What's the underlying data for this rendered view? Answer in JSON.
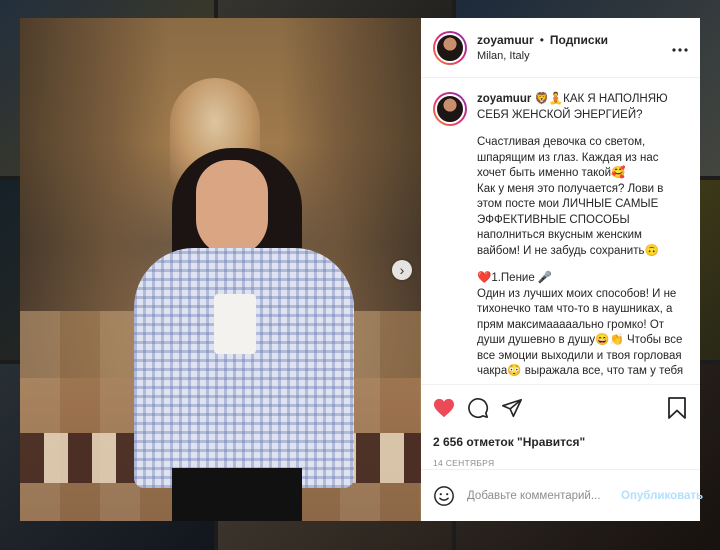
{
  "post": {
    "username": "zoyamuur",
    "separator": "•",
    "follow_label": "Подписки",
    "location": "Milan, Italy",
    "more_icon": "more-horizontal-icon",
    "carousel": {
      "total_slides": 2,
      "current_slide": 1
    },
    "caption": {
      "title": "🦁🧘КАК Я НАПОЛНЯЮ СЕБЯ ЖЕНСКОЙ ЭНЕРГИЕЙ?",
      "p1": "Счастливая девочка со светом, шпарящим из глаз. Каждая из нас хочет быть именно такой🥰",
      "p2": "Как у меня это получается? Лови в этом посте мои ЛИЧНЫЕ САМЫЕ ЭФФЕКТИВНЫЕ СПОСОБЫ наполниться вкусным женским вайбом! И не забудь сохранить🙃",
      "p3_head": "❤️1.Пение 🎤",
      "p3": "Один из лучших моих способов! И не тихонечко там что-то в наушниках, а прям максимааааально громко! От души душевно в душу😄👏 Чтобы все все эмоции выходили и твоя горловая чакра😳 выражала все, что там у тебя"
    },
    "likes_text": "2 656 отметок \"Нравится\"",
    "date": "14 СЕНТЯБРЯ",
    "comment_placeholder": "Добавьте комментарий...",
    "publish_label": "Опубликовать",
    "colors": {
      "like": "#ed4956",
      "link": "#3897f0",
      "publish_disabled": "#b2dffc"
    }
  }
}
